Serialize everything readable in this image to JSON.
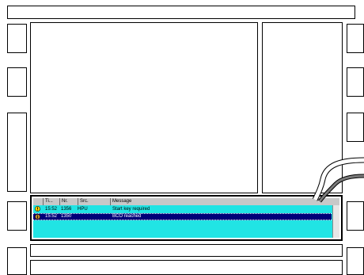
{
  "alarm_list": {
    "columns": [
      "Ti...",
      "Nr.",
      "Src.",
      "Message"
    ],
    "rows": [
      {
        "time": "15:52",
        "nr": "1356",
        "src": "HPU",
        "message": "Start key required",
        "type": "warning-icon"
      },
      {
        "time": "15:52",
        "nr": "1350",
        "src": "",
        "message": "BCO reached",
        "type": "info-icon",
        "selected": true
      }
    ]
  },
  "colors": {
    "panel_bg": "#21e4e4",
    "selected_row": "#000078",
    "warning": "#ffd400"
  }
}
